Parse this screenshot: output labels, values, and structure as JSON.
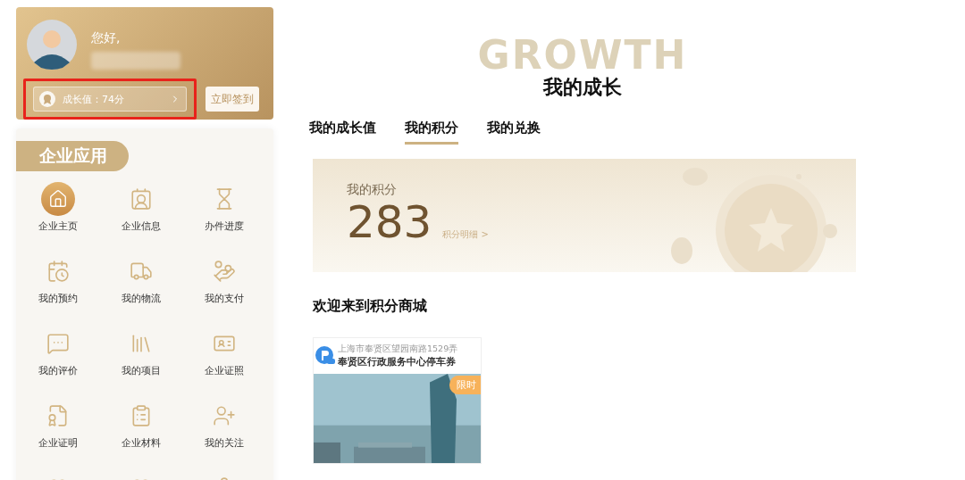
{
  "profile": {
    "greeting": "您好,",
    "growth_value": "成长值：74分",
    "sign_in_button": "立即签到"
  },
  "apps": {
    "title": "企业应用",
    "items": [
      {
        "label": "企业主页",
        "selected": true
      },
      {
        "label": "企业信息",
        "selected": false
      },
      {
        "label": "办件进度",
        "selected": false
      },
      {
        "label": "我的预约",
        "selected": false
      },
      {
        "label": "我的物流",
        "selected": false
      },
      {
        "label": "我的支付",
        "selected": false
      },
      {
        "label": "我的评价",
        "selected": false
      },
      {
        "label": "我的项目",
        "selected": false
      },
      {
        "label": "企业证照",
        "selected": false
      },
      {
        "label": "企业证明",
        "selected": false
      },
      {
        "label": "企业材料",
        "selected": false
      },
      {
        "label": "我的关注",
        "selected": false
      }
    ]
  },
  "main": {
    "watermark": "GROWTH",
    "title": "我的成长",
    "tabs": [
      {
        "label": "我的成长值",
        "selected": false
      },
      {
        "label": "我的积分",
        "selected": true
      },
      {
        "label": "我的兑换",
        "selected": false
      }
    ],
    "points": {
      "label": "我的积分",
      "value": "283",
      "detail_link": "积分明细 >"
    },
    "store_heading": "欢迎来到积分商城",
    "product": {
      "address": "上海市奉贤区望园南路1529弄",
      "title": "奉贤区行政服务中心停车券",
      "badge": "限时"
    }
  }
}
